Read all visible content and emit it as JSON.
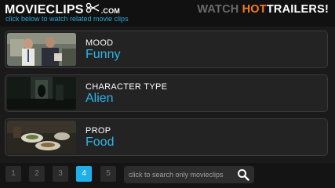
{
  "header": {
    "logo_text": "MOVIECLIPS",
    "logo_suffix": ".COM",
    "subtitle": "click below to watch related movie clips",
    "promo_watch": "WATCH ",
    "promo_hot": "HOT",
    "promo_trailers": "TRAILERS!"
  },
  "rows": [
    {
      "category": "MOOD",
      "value": "Funny",
      "thumb_icon": "office-scene-thumbnail"
    },
    {
      "category": "CHARACTER TYPE",
      "value": "Alien",
      "thumb_icon": "dark-corridor-thumbnail"
    },
    {
      "category": "PROP",
      "value": "Food",
      "thumb_icon": "food-plates-thumbnail"
    }
  ],
  "pager": {
    "pages": [
      "1",
      "2",
      "3",
      "4",
      "5"
    ],
    "active_page": "4"
  },
  "search": {
    "placeholder": "click to search only movieclips"
  },
  "colors": {
    "accent_blue": "#2fb5e8",
    "hot_orange": "#f47a20",
    "background": "#1a1a1a"
  }
}
